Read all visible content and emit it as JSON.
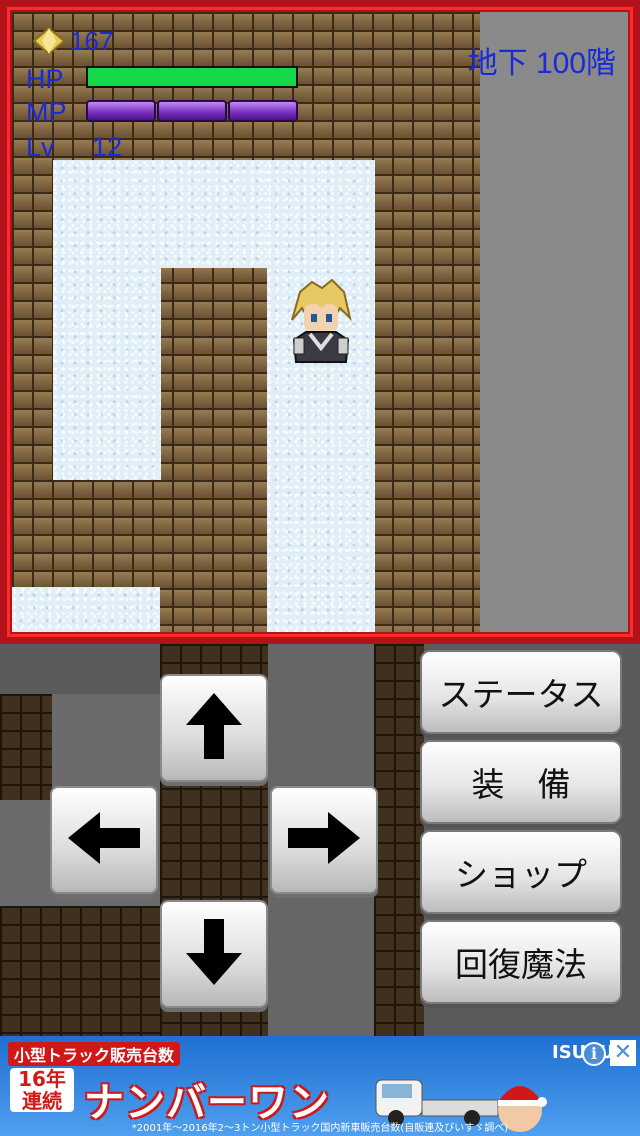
{
  "hud": {
    "gem_count": "167",
    "floor": "地下 100階",
    "hp_label": "HP",
    "mp_label": "MP",
    "lv_label": "Lv",
    "level": "12",
    "hp_fraction": 1.0,
    "mp_segments_filled": 3,
    "mp_segments_total": 3
  },
  "dpad": {
    "up": "up-arrow-icon",
    "down": "down-arrow-icon",
    "left": "left-arrow-icon",
    "right": "right-arrow-icon"
  },
  "menu": {
    "status": "ステータス",
    "equip": "装　備",
    "shop": "ショップ",
    "heal": "回復魔法"
  },
  "ad": {
    "top_line": "小型トラック販売台数",
    "years": "16年\n連続",
    "headline": "ナンバーワン",
    "fineprint": "*2001年〜2016年2〜3トン小型トラック国内新車販売台数(自販連及びいすゞ調べ)",
    "brand": "ISUZU"
  },
  "colors": {
    "frame": "#b3121a",
    "hud_text": "#1a2bd6",
    "hp_bar": "#16d94a",
    "mp_bar": "#7a32c4"
  }
}
